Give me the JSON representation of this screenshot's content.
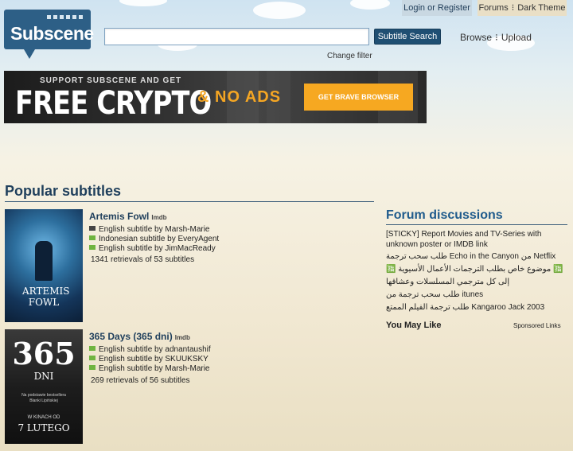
{
  "header": {
    "logo_text": "Subscene",
    "search_placeholder": "",
    "search_button": "Subtitle Search",
    "change_filter": "Change filter",
    "browse": "Browse",
    "upload": "Upload",
    "login": "Login or Register",
    "forums": "Forums",
    "dark_theme": "Dark Theme"
  },
  "banner": {
    "top_text": "SUPPORT SUBSCENE AND GET",
    "main_text": "FREE CRYPTO",
    "sub_text": "& NO ADS",
    "button": "GET BRAVE BROWSER"
  },
  "popular": {
    "title": "Popular subtitles",
    "films": [
      {
        "title": "Artemis Fowl",
        "imdb": "Imdb",
        "poster_text": "ARTEMIS FOWL",
        "subs": [
          {
            "text": "English subtitle by Marsh-Marie",
            "flag": "#444444"
          },
          {
            "text": "Indonesian subtitle by EveryAgent",
            "flag": "#6fb43f"
          },
          {
            "text": "English subtitle by JimMacReady",
            "flag": "#6fb43f"
          }
        ],
        "retrievals": "1341 retrievals of 53 subtitles"
      },
      {
        "title": "365 Days (365 dni)",
        "imdb": "Imdb",
        "poster_text": "365",
        "poster_sub": "DNI",
        "poster_small1": "Na podstawie bestsellera",
        "poster_small2": "Blanki Lipińskiej",
        "poster_small3": "W KINACH OD",
        "poster_date": "7 LUTEGO",
        "subs": [
          {
            "text": "English subtitle by adnantaushif",
            "flag": "#6fb43f"
          },
          {
            "text": "English subtitle by SKUUKSKY",
            "flag": "#6fb43f"
          },
          {
            "text": "English subtitle by Marsh-Marie",
            "flag": "#6fb43f"
          }
        ],
        "retrievals": "269 retrievals of 56 subtitles"
      }
    ]
  },
  "forum": {
    "title": "Forum discussions",
    "items": [
      "[STICKY] Report Movies and TV-Series with unknown poster or IMDB link",
      "طلب سحب ترجمة Echo in the Canyon من Netflix",
      "🈯 موضوع خاص بطلب الترجمات الأعمال الأسيوية 🈯",
      "إلى كل مترجمي المسلسلات وعشاقها",
      "طلب سحب ترجمة من itunes",
      "طلب ترجمة الفيلم الممتع Kangaroo Jack 2003"
    ],
    "you_may_like": "You May Like",
    "sponsored": "Sponsored Links"
  }
}
